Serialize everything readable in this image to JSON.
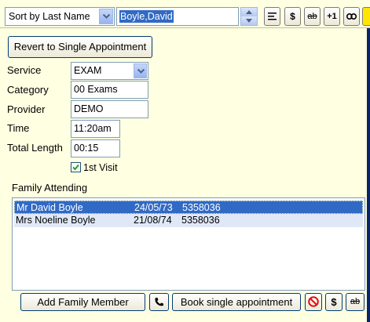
{
  "toolbar": {
    "sort_value": "Sort by Last Name",
    "patient_name": "Boyle,David",
    "buttons": [
      {
        "name": "align-button",
        "label": ""
      },
      {
        "name": "dollar-button",
        "label": "$"
      },
      {
        "name": "strikethrough-button",
        "label": "ab"
      },
      {
        "name": "plus-one-button",
        "label": "+1"
      },
      {
        "name": "link-button",
        "label": ""
      },
      {
        "name": "note-button",
        "label": ""
      }
    ]
  },
  "revert_button": "Revert to Single Appointment",
  "form": {
    "service_label": "Service",
    "service_value": "EXAM",
    "category_label": "Category",
    "category_value": "00 Exams",
    "provider_label": "Provider",
    "provider_value": "DEMO",
    "time_label": "Time",
    "time_value": "11:20am",
    "length_label": "Total Length",
    "length_value": "00:15",
    "first_visit_label": "1st Visit",
    "first_visit_checked": true
  },
  "family": {
    "heading": "Family Attending",
    "rows": [
      {
        "name": "Mr David Boyle",
        "dob": "24/05/73",
        "id": "5358036",
        "selected": true
      },
      {
        "name": "Mrs Noeline Boyle",
        "dob": "21/08/74",
        "id": "5358036",
        "selected": false
      }
    ]
  },
  "footer": {
    "add_family_label": "Add Family Member",
    "book_single_label": "Book single appointment",
    "dollar_label": "$",
    "strike_label": "ab"
  },
  "colors": {
    "background": "#ffffe1",
    "selection": "#316ac5",
    "accent_border": "#0a246a"
  }
}
